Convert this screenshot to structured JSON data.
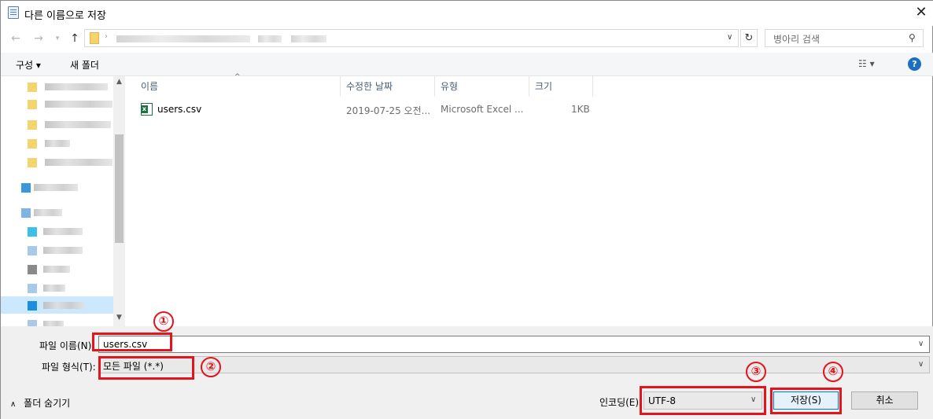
{
  "window": {
    "title": "다른 이름으로 저장",
    "close_glyph": "✕"
  },
  "address": {
    "search_placeholder": "병아리 검색",
    "refresh_glyph": "↻",
    "sep_glyph": "›"
  },
  "toolbar": {
    "organize": "구성 ▾",
    "new_folder": "새 폴더",
    "help": "?"
  },
  "columns": [
    "이름",
    "수정한 날짜",
    "유형",
    "크기"
  ],
  "files": [
    {
      "name": "users.csv",
      "modified": "2019-07-25 오전...",
      "type": "Microsoft Excel ...",
      "size": "1KB"
    }
  ],
  "form": {
    "filename_label": "파일 이름(N):",
    "filename_value": "users.csv",
    "filetype_label": "파일 형식(T):",
    "filetype_value": "모든 파일 (*.*)",
    "encoding_label": "인코딩(E):",
    "encoding_value": "UTF-8",
    "save_button": "저장(S)",
    "cancel_button": "취소",
    "hide_folders": "폴더 숨기기"
  },
  "annotations": [
    "①",
    "②",
    "③",
    "④"
  ],
  "colors": {
    "annotation_red": "#e3141b",
    "accent_blue": "#0078d7",
    "excel_green": "#1e7145"
  }
}
